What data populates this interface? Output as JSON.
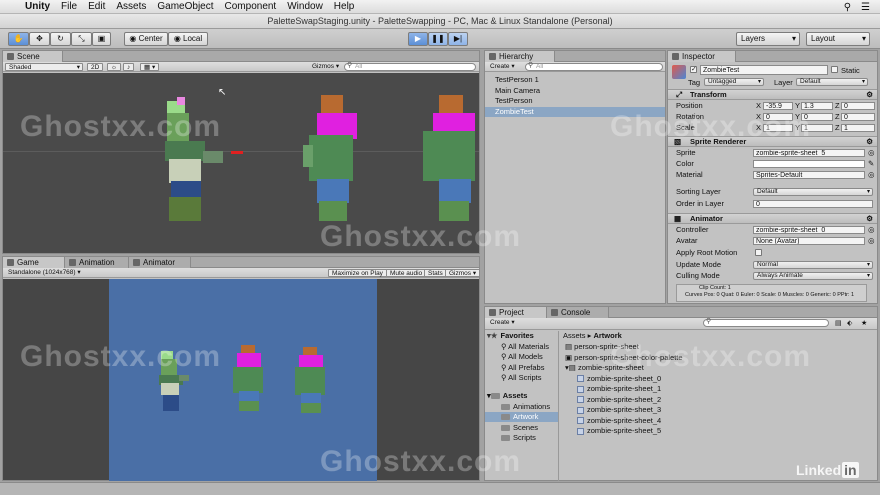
{
  "menubar": {
    "app": "Unity",
    "items": [
      "File",
      "Edit",
      "Assets",
      "GameObject",
      "Component",
      "Window",
      "Help"
    ]
  },
  "window_title": "PaletteSwapStaging.unity - PaletteSwapping - PC, Mac & Linux Standalone (Personal)",
  "toolbar": {
    "center": "Center",
    "local": "Local",
    "layers": "Layers",
    "layout": "Layout"
  },
  "scene": {
    "tab": "Scene",
    "shading": "Shaded",
    "mode2d": "2D",
    "gizmos": "Gizmos",
    "search": "All"
  },
  "game": {
    "tab": "Game",
    "tab_animation": "Animation",
    "tab_animator": "Animator",
    "resolution": "Standalone (1024x768)",
    "maximize": "Maximize on Play",
    "mute": "Mute audio",
    "stats": "Stats",
    "gizmos": "Gizmos"
  },
  "hierarchy": {
    "tab": "Hierarchy",
    "create": "Create",
    "search": "All",
    "items": [
      "TestPerson 1",
      "Main Camera",
      "TestPerson",
      "ZombieTest"
    ],
    "selected_index": 3
  },
  "inspector": {
    "tab": "Inspector",
    "object_name": "ZombieTest",
    "static": "Static",
    "tag_label": "Tag",
    "tag": "Untagged",
    "layer_label": "Layer",
    "layer": "Default",
    "transform": {
      "title": "Transform",
      "position_label": "Position",
      "rotation_label": "Rotation",
      "scale_label": "Scale",
      "position": {
        "x": "-35.9",
        "y": "1.3",
        "z": "0"
      },
      "rotation": {
        "x": "0",
        "y": "0",
        "z": "0"
      },
      "scale": {
        "x": "1",
        "y": "1",
        "z": "1"
      }
    },
    "sprite_renderer": {
      "title": "Sprite Renderer",
      "sprite_label": "Sprite",
      "sprite": "zombie-sprite-sheet_5",
      "color_label": "Color",
      "material_label": "Material",
      "material": "Sprites-Default",
      "sorting_label": "Sorting Layer",
      "sorting": "Default",
      "order_label": "Order in Layer",
      "order": "0"
    },
    "animator": {
      "title": "Animator",
      "controller_label": "Controller",
      "controller": "zombie-sprite-sheet_0",
      "avatar_label": "Avatar",
      "avatar": "None (Avatar)",
      "root_motion_label": "Apply Root Motion",
      "update_label": "Update Mode",
      "update": "Normal",
      "culling_label": "Culling Mode",
      "culling": "Always Animate",
      "info1": "Clip Count: 1",
      "info2": "Curves Pos: 0 Quat: 0 Euler: 0 Scale: 0 Muscles: 0 Generic: 0 PPtr: 1"
    }
  },
  "project": {
    "tab": "Project",
    "tab_console": "Console",
    "create": "Create",
    "favorites_label": "Favorites",
    "favorites": [
      "All Materials",
      "All Models",
      "All Prefabs",
      "All Scripts"
    ],
    "assets_label": "Assets",
    "asset_folders": [
      "Animations",
      "Artwork",
      "Scenes",
      "Scripts"
    ],
    "breadcrumb_root": "Assets",
    "breadcrumb_sep": "▸",
    "breadcrumb_current": "Artwork",
    "files": [
      "person-sprite-sheet",
      "person-sprite-sheet-color-palette",
      "zombie-sprite-sheet"
    ],
    "subfiles": [
      "zombie-sprite-sheet_0",
      "zombie-sprite-sheet_1",
      "zombie-sprite-sheet_2",
      "zombie-sprite-sheet_3",
      "zombie-sprite-sheet_4",
      "zombie-sprite-sheet_5"
    ]
  },
  "watermark": "Ghostxx.com",
  "linkedin": "Linked",
  "linkedin_in": "in",
  "colors": {
    "zombie_green": "#5a9a5a",
    "magenta": "#e020e0",
    "hair": "#b86a30",
    "jeans": "#4a78b8",
    "game_bg": "#4a6fa6"
  }
}
